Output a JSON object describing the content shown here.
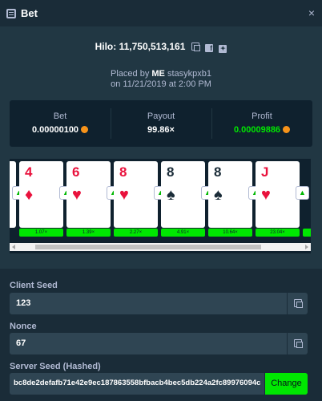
{
  "window": {
    "title": "Bet",
    "close_glyph": "×"
  },
  "bet": {
    "game": "Hilo:",
    "id": "11,750,513,161",
    "placed_by_prefix": "Placed by",
    "user_tag": "ME",
    "username": "stasykpxb1",
    "on_date": "on 11/21/2019 at 2:00 PM"
  },
  "stats": {
    "bet_label": "Bet",
    "bet_value": "0.00000100",
    "payout_label": "Payout",
    "payout_value": "99.86×",
    "profit_label": "Profit",
    "profit_value": "0.00009886"
  },
  "cards": [
    {
      "rank": "",
      "suit": "♥",
      "color": "red",
      "multiplier": ""
    },
    {
      "rank": "4",
      "suit": "♦",
      "color": "red",
      "multiplier": "1.07×"
    },
    {
      "rank": "6",
      "suit": "♥",
      "color": "red",
      "multiplier": "1.39×"
    },
    {
      "rank": "8",
      "suit": "♥",
      "color": "red",
      "multiplier": "2.27×"
    },
    {
      "rank": "8",
      "suit": "♠",
      "color": "black",
      "multiplier": "4.91×"
    },
    {
      "rank": "8",
      "suit": "♠",
      "color": "black",
      "multiplier": "10.64×"
    },
    {
      "rank": "J",
      "suit": "♥",
      "color": "red",
      "multiplier": "23.04×"
    },
    {
      "rank": "",
      "suit": "",
      "color": "red",
      "multiplier": ""
    }
  ],
  "fields": {
    "client_seed_label": "Client Seed",
    "client_seed": "123",
    "nonce_label": "Nonce",
    "nonce": "67",
    "server_seed_label": "Server Seed (Hashed)",
    "server_seed": "bc8de2defafb71e42e9ec187863558bfbacb4bec5db224a2fc89976094c",
    "change_label": "Change"
  },
  "colors": {
    "accent_green": "#00e701",
    "card_red": "#e9113c",
    "bg": "#1a2c38"
  }
}
